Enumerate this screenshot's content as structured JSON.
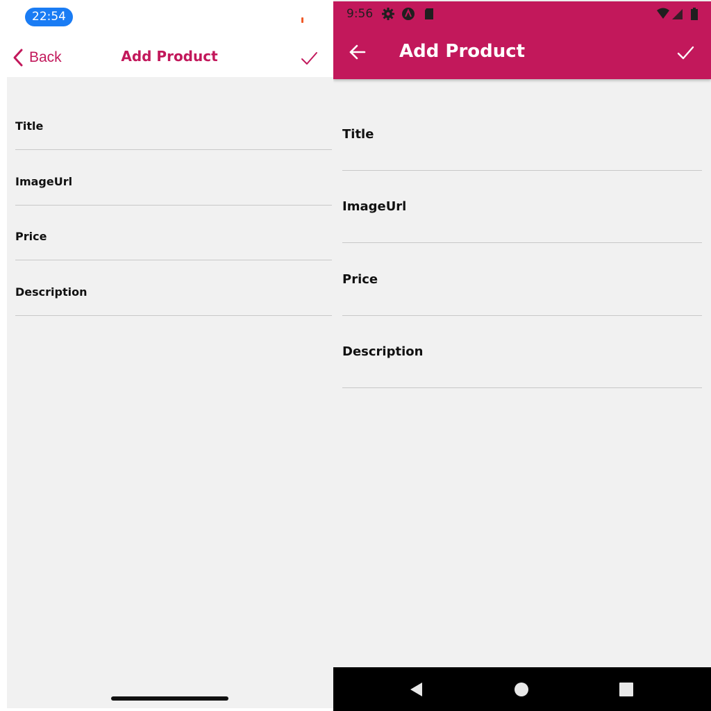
{
  "ios": {
    "status_time": "22:54",
    "nav": {
      "back_label": "Back",
      "title": "Add Product",
      "confirm_icon": "checkmark-icon"
    },
    "fields": [
      {
        "label": "Title"
      },
      {
        "label": "ImageUrl"
      },
      {
        "label": "Price"
      },
      {
        "label": "Description"
      }
    ],
    "accent_color": "#c2185b",
    "time_pill_color": "#1a7cf4"
  },
  "android": {
    "status_time": "9:56",
    "status_icons": [
      "settings-icon",
      "app-badge-icon",
      "sd-card-icon",
      "wifi-icon",
      "cell-signal-icon",
      "battery-icon"
    ],
    "appbar": {
      "title": "Add Product",
      "back_icon": "arrow-back-icon",
      "confirm_icon": "checkmark-icon"
    },
    "fields": [
      {
        "label": "Title"
      },
      {
        "label": "ImageUrl"
      },
      {
        "label": "Price"
      },
      {
        "label": "Description"
      }
    ],
    "nav_buttons": [
      "back-triangle-icon",
      "home-circle-icon",
      "recents-square-icon"
    ],
    "appbar_color": "#c2185b"
  }
}
